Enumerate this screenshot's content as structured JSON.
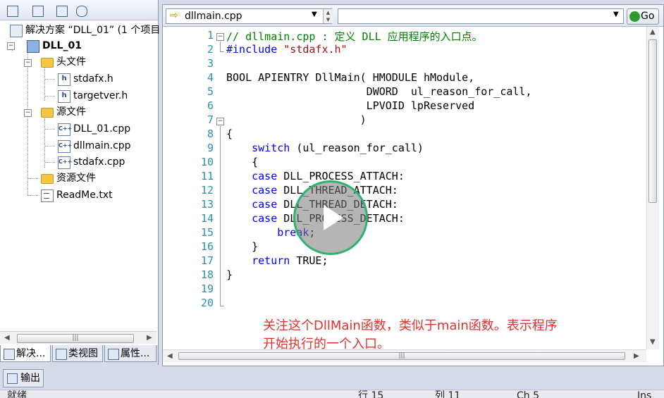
{
  "solution_explorer": {
    "toolbar_icons": [
      "properties-icon",
      "show-all-files-icon",
      "view-code-icon",
      "class-diagram-icon"
    ],
    "tree": [
      {
        "label": "解决方案 “DLL_01” (1 个项目",
        "icon": "solution-icon",
        "level": 0,
        "bold": false
      },
      {
        "label": "DLL_01",
        "icon": "project-icon",
        "level": 0,
        "bold": true
      },
      {
        "label": "头文件",
        "icon": "folder-icon",
        "level": 1
      },
      {
        "label": "stdafx.h",
        "icon": "header-file-icon",
        "level": 2
      },
      {
        "label": "targetver.h",
        "icon": "header-file-icon",
        "level": 2
      },
      {
        "label": "源文件",
        "icon": "folder-icon",
        "level": 1
      },
      {
        "label": "DLL_01.cpp",
        "icon": "cpp-file-icon",
        "level": 2
      },
      {
        "label": "dllmain.cpp",
        "icon": "cpp-file-icon",
        "level": 2
      },
      {
        "label": "stdafx.cpp",
        "icon": "cpp-file-icon",
        "level": 2
      },
      {
        "label": "资源文件",
        "icon": "folder-icon",
        "level": 1
      },
      {
        "label": "ReadMe.txt",
        "icon": "text-file-icon",
        "level": 1
      }
    ],
    "tabs": [
      "解决...",
      "类视图",
      "属性..."
    ]
  },
  "editor": {
    "file_combo": "dllmain.cpp",
    "member_combo": "",
    "go_label": "Go",
    "line_numbers": [
      "1",
      "2",
      "3",
      "4",
      "5",
      "6",
      "7",
      "8",
      "9",
      "10",
      "11",
      "12",
      "13",
      "14",
      "15",
      "16",
      "17",
      "18",
      "19",
      "20"
    ],
    "code_lines": [
      "// dllmain.cpp : 定义 DLL 应用程序的入口点。",
      "#include \"stdafx.h\"",
      "",
      "BOOL APIENTRY DllMain( HMODULE hModule,",
      "                      DWORD  ul_reason_for_call,",
      "                      LPVOID lpReserved",
      "                     )",
      "{",
      "    switch (ul_reason_for_call)",
      "    {",
      "    case DLL_PROCESS_ATTACH:",
      "    case DLL_THREAD_ATTACH:",
      "    case DLL_THREAD_DETACH:",
      "    case DLL_PROCESS_DETACH:",
      "        break;",
      "    }",
      "    return TRUE;",
      "}",
      "",
      ""
    ],
    "caption_line1": "关注这个DllMain函数，类似于main函数。表示程序",
    "caption_line2": "开始执行的一个入口。",
    "overlay_icon": "play-icon"
  },
  "bottom": {
    "output_tab": "输出"
  },
  "status_bar": {
    "ready": "就绪",
    "line": "行 15",
    "col": "列 11",
    "ch": "Ch 5",
    "ins": "Ins"
  }
}
